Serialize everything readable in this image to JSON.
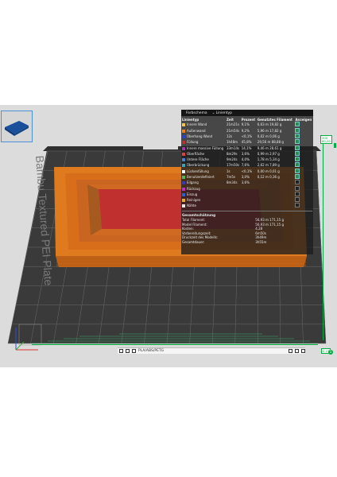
{
  "legend": {
    "tab_active": "Farbschema",
    "tab_dropdown": "Linientyp",
    "columns": [
      "Linientyp",
      "Zeit",
      "Prozent",
      "Genutztes Filament",
      "Anzeigen"
    ],
    "rows": [
      {
        "name": "Innere Wand",
        "time": "21m21s",
        "percent": "9,1%",
        "filament": "6,63 m  19,82 g",
        "color": "#f5c842",
        "shown": true
      },
      {
        "name": "Außenwand",
        "time": "21m54s",
        "percent": "9,2%",
        "filament": "5,96 m  17,82 g",
        "color": "#ff7f00",
        "shown": true
      },
      {
        "name": "Überhang Wand",
        "time": "12s",
        "percent": "<0,1%",
        "filament": "0,02 m  0,06 g",
        "color": "#2a3fd6",
        "shown": true
      },
      {
        "name": "Füllung",
        "time": "1h48m",
        "percent": "45,8%",
        "filament": "29,56 m  88,88 g",
        "color": "#b83030",
        "shown": true
      },
      {
        "name": "Innere massive Füllung",
        "time": "33m14s",
        "percent": "14,1%",
        "filament": "9,46 m  28,61 g",
        "color": "#9a3ca0",
        "shown": true
      },
      {
        "name": "Oberfläche",
        "time": "8m29s",
        "percent": "3,6%",
        "filament": "0,99 m  2,97 g",
        "color": "#e04040",
        "shown": true
      },
      {
        "name": "Untere Fläche",
        "time": "9m24s",
        "percent": "4,0%",
        "filament": "1,78 m  5,34 g",
        "color": "#4a80d0",
        "shown": true
      },
      {
        "name": "Überbrückung",
        "time": "17m50s",
        "percent": "7,6%",
        "filament": "2,62 m  7,89 g",
        "color": "#46a0b4",
        "shown": true
      },
      {
        "name": "Lückenfüllung",
        "time": "1s",
        "percent": "<0,1%",
        "filament": "0,00 m  0,01 g",
        "color": "#ffffff",
        "shown": true
      },
      {
        "name": "Benutzerdefiniert",
        "time": "7m5s",
        "percent": "3,0%",
        "filament": "0,12 m  0,36 g",
        "color": "#5ab45a",
        "shown": true
      },
      {
        "name": "Eilgang",
        "time": "8m34s",
        "percent": "3,6%",
        "filament": "",
        "color": "#3838c8",
        "shown": false
      },
      {
        "name": "Rückzug",
        "time": "",
        "percent": "",
        "filament": "",
        "color": "#c030c0",
        "shown": false
      },
      {
        "name": "Einzug",
        "time": "",
        "percent": "",
        "filament": "",
        "color": "#3060d0",
        "shown": false
      },
      {
        "name": "Reinigen",
        "time": "",
        "percent": "",
        "filament": "",
        "color": "#e0b020",
        "shown": false
      },
      {
        "name": "Nähte",
        "time": "",
        "percent": "",
        "filament": "",
        "color": "#e8e8e8",
        "shown": false
      }
    ],
    "summary_title": "Gesamtschätzung",
    "summary": [
      {
        "label": "Total Filament:",
        "value": "56,93 m   171,15 g"
      },
      {
        "label": "Model Filament:",
        "value": "56,93 m   171,15 g"
      },
      {
        "label": "Kosten:",
        "value": "4,28"
      },
      {
        "label": "Vorbereitungszeit:",
        "value": "6m50s"
      },
      {
        "label": "Druckzeit des Modells:",
        "value": "3h49m"
      },
      {
        "label": "Gesamtdauer:",
        "value": "3h55m"
      }
    ]
  },
  "plate": {
    "label": "Bambu Textured PEI Plate",
    "color": "#3b3b3b"
  },
  "slider": {
    "top_value": "200",
    "top_sub": "60,00",
    "bottom_value": "0,27",
    "bottom_index": "1",
    "accent": "#00ae42"
  },
  "toolbar": {
    "filament_label": "PLA/ABS/PETG"
  },
  "colors": {
    "model_outer": "#e07a1f",
    "model_infill": "#c0302f",
    "viewport_bg": "#dcdcdc"
  }
}
